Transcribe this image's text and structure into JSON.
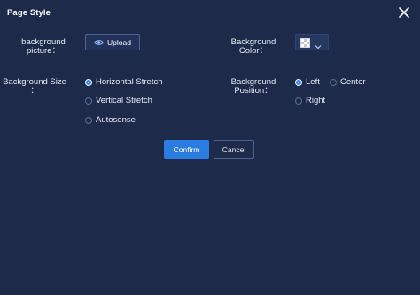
{
  "dialog": {
    "title": "Page Style",
    "close_icon": "close-icon"
  },
  "fields": {
    "background_picture_label_1": "background",
    "background_picture_label_2": "picture：",
    "upload_label": "Upload",
    "upload_icon": "eye-icon",
    "background_color_label_1": "Background",
    "background_color_label_2": "Color：",
    "background_size_label_1": "Background Size",
    "background_size_label_2": "：",
    "background_position_label_1": "Background",
    "background_position_label_2": "Position："
  },
  "size_options": [
    {
      "label": "Horizontal Stretch",
      "selected": true
    },
    {
      "label": "Vertical Stretch",
      "selected": false
    },
    {
      "label": "Autosense",
      "selected": false
    }
  ],
  "position_options": [
    {
      "label": "Left",
      "selected": true
    },
    {
      "label": "Center",
      "selected": false
    },
    {
      "label": "Right",
      "selected": false
    }
  ],
  "actions": {
    "confirm": "Confirm",
    "cancel": "Cancel"
  },
  "colors": {
    "background": "#1d2a4a",
    "accent": "#2a7ce0"
  }
}
